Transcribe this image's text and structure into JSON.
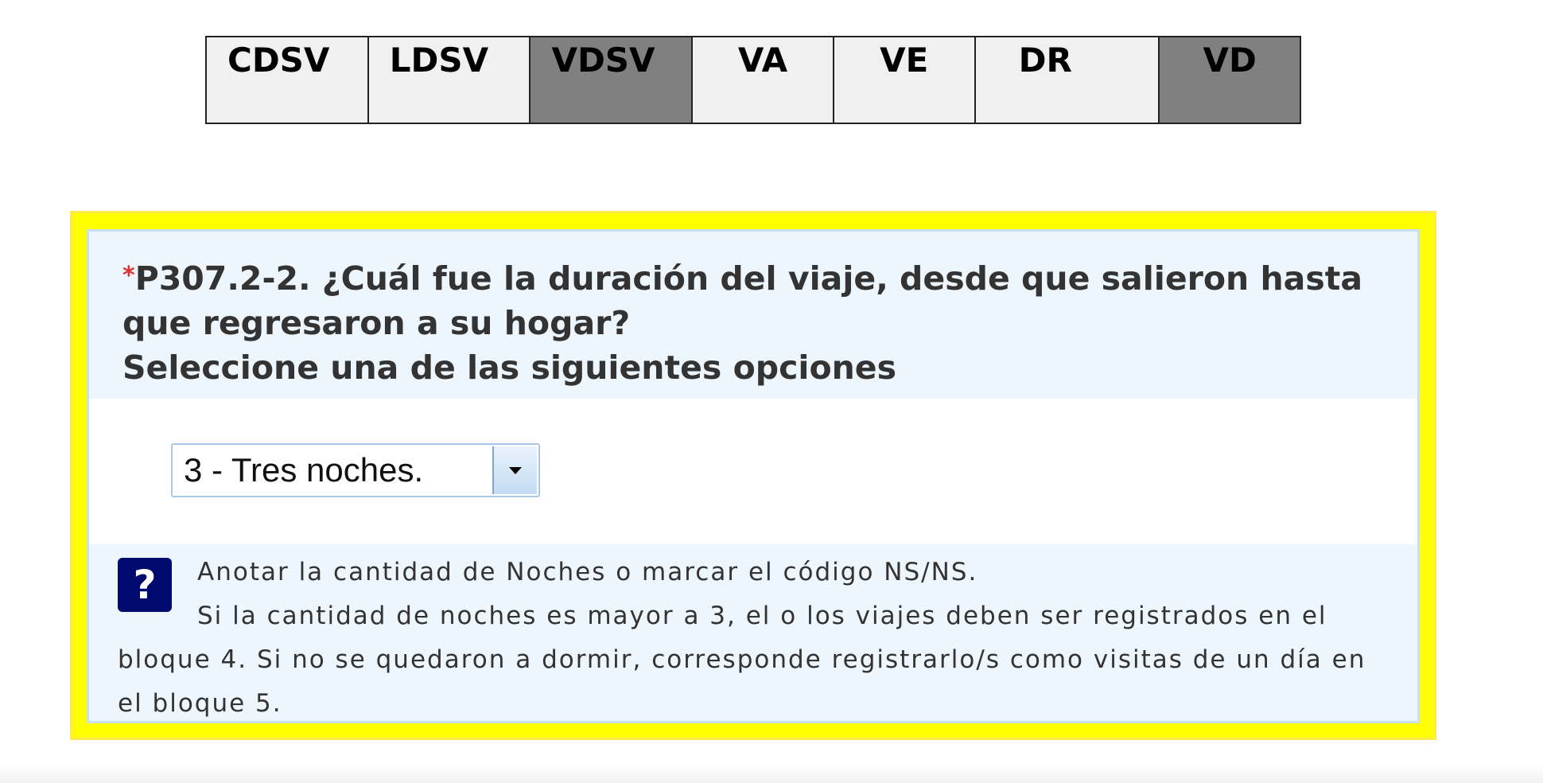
{
  "nav": {
    "tabs": [
      {
        "label": "CDSV",
        "active": false
      },
      {
        "label": "LDSV",
        "active": false
      },
      {
        "label": "VDSV",
        "active": true
      },
      {
        "label": "VA",
        "active": false
      },
      {
        "label": "VE",
        "active": false
      },
      {
        "label": "DR",
        "active": false
      },
      {
        "label": "VD",
        "active": true
      }
    ],
    "colors": {
      "active": "#808080",
      "inactive": "#f0f0f0"
    }
  },
  "question": {
    "required_marker": "*",
    "text": "P307.2-2. ¿Cuál fue la duración del viaje, desde que salieron hasta que regresaron a su hogar?",
    "instruction": "Seleccione una de las siguientes opciones"
  },
  "answer": {
    "selected_value": "3 - Tres noches.",
    "dropdown_icon": "chevron-down-icon"
  },
  "help": {
    "icon_label": "?",
    "icon": "help-icon",
    "line1": "Anotar la cantidad de Noches o marcar el código NS/NS.",
    "line2": "Si la cantidad de noches es mayor a 3, el o los viajes deben ser registrados en el bloque 4. Si no se quedaron a dormir, corresponde registrarlo/s como visitas de un día en el bloque 5."
  },
  "colors": {
    "frame": "#ffff00",
    "panel_bg": "#edf5fd",
    "help_icon_bg": "#000a6e",
    "required": "#e03030"
  }
}
